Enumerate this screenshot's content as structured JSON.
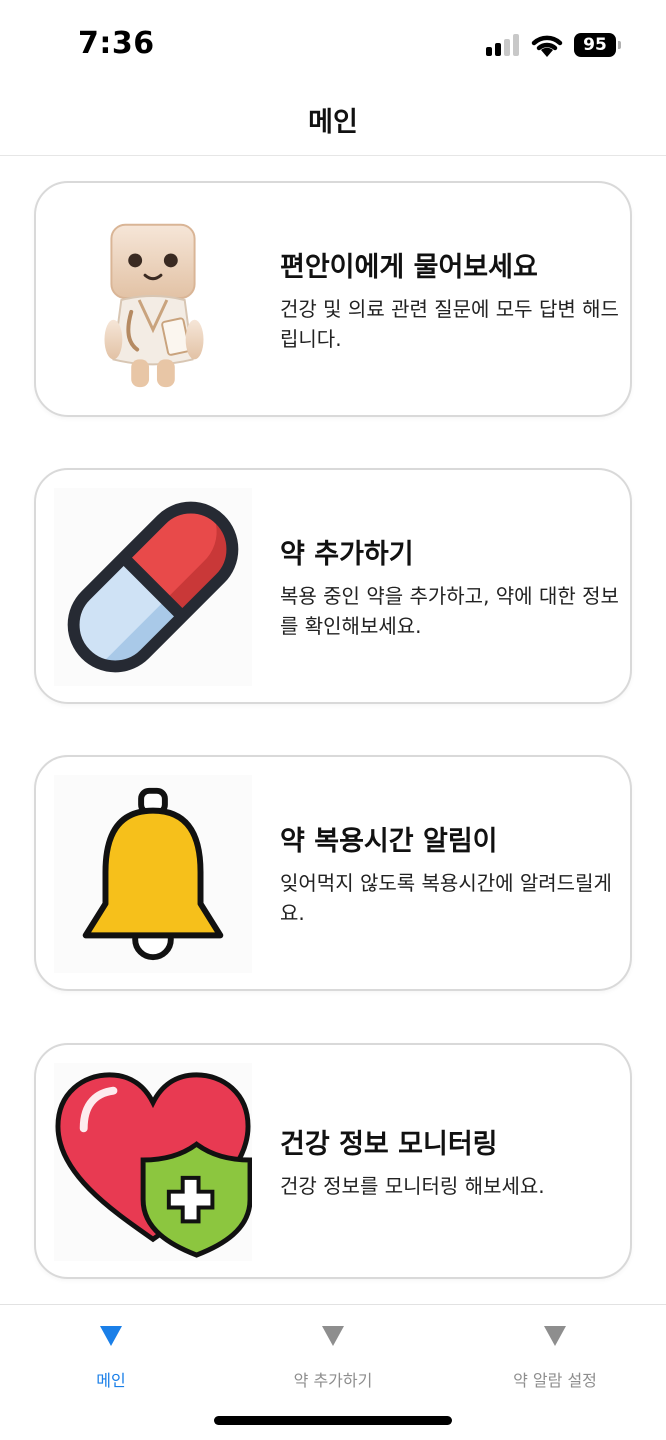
{
  "status_bar": {
    "time": "7:36",
    "battery": "95"
  },
  "header": {
    "title": "메인"
  },
  "cards": [
    {
      "icon": "doctor-robot-icon",
      "title": "편안이에게 물어보세요",
      "description": "건강 및 의료 관련 질문에 모두 답변 해드립니다."
    },
    {
      "icon": "pill-capsule-icon",
      "title": "약 추가하기",
      "description": "복용 중인 약을 추가하고, 약에 대한 정보를 확인해보세요."
    },
    {
      "icon": "bell-icon",
      "title": "약 복용시간 알림이",
      "description": "잊어먹지 않도록 복용시간에 알려드릴게요."
    },
    {
      "icon": "heart-shield-icon",
      "title": "건강 정보 모니터링",
      "description": "건강 정보를 모니터링 해보세요."
    }
  ],
  "tab_bar": {
    "tabs": [
      {
        "label": "메인",
        "icon": "triangle-down-icon",
        "active": true
      },
      {
        "label": "약 추가하기",
        "icon": "triangle-down-icon",
        "active": false
      },
      {
        "label": "약 알람 설정",
        "icon": "triangle-down-icon",
        "active": false
      }
    ]
  },
  "colors": {
    "accent": "#1a7fe8",
    "tab_inactive": "#8e8e8e",
    "card_border": "#d9d9d9",
    "pill_red": "#e84a4a",
    "pill_blue": "#cfe2f5",
    "bell_yellow": "#f6c01b",
    "heart_red": "#e83a52",
    "shield_green": "#8cc63f"
  }
}
